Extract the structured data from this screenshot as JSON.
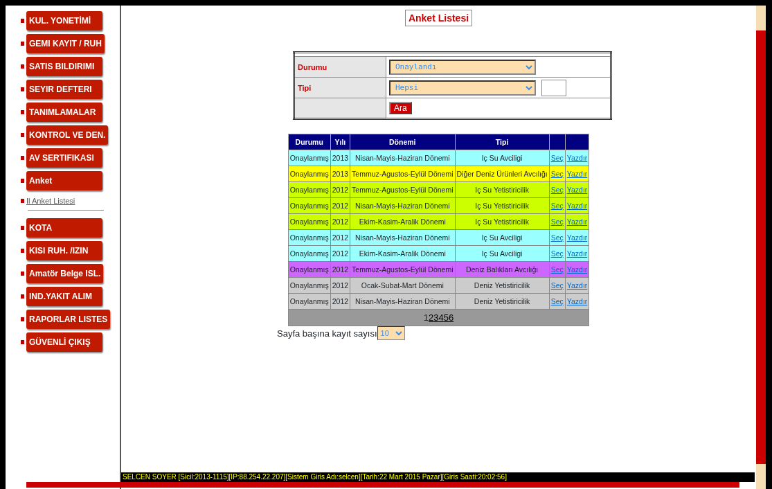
{
  "sidebar": {
    "items": [
      {
        "label": "KUL. YONETİMİ",
        "kind": "menu"
      },
      {
        "label": "GEMI KAYIT / RUH",
        "kind": "menu"
      },
      {
        "label": "SATIS BILDIRIMI",
        "kind": "menu"
      },
      {
        "label": "SEYIR DEFTERI",
        "kind": "menu"
      },
      {
        "label": "TANIMLAMALAR",
        "kind": "menu"
      },
      {
        "label": "KONTROL VE DEN.",
        "kind": "menu"
      },
      {
        "label": "AV SERTIFIKASI",
        "kind": "menu"
      },
      {
        "label": "Anket",
        "kind": "menu"
      },
      {
        "label": "Il Anket Listesi",
        "kind": "sub"
      },
      {
        "label": "KOTA",
        "kind": "menu"
      },
      {
        "label": "KISI RUH. /IZIN",
        "kind": "menu"
      },
      {
        "label": "Amatör Belge ISL.",
        "kind": "menu"
      },
      {
        "label": "IND.YAKIT ALIM",
        "kind": "menu"
      },
      {
        "label": "RAPORLAR LISTES",
        "kind": "menu"
      },
      {
        "label": "GÜVENLİ ÇIKIŞ",
        "kind": "menu"
      }
    ]
  },
  "page_title": "Anket Listesi",
  "filters": {
    "durumu": {
      "label": "Durumu",
      "value": "Onaylandı"
    },
    "tipi": {
      "label": "Tipi",
      "value": "Hepsi"
    },
    "search_button": "Ara"
  },
  "table": {
    "columns": [
      "Durumu",
      "Yılı",
      "Dönemi",
      "Tipi"
    ],
    "rows": [
      {
        "color": "#99ffff",
        "cells": [
          "Onaylanmış",
          "2013",
          "Nisan-Mayis-Haziran Dönemi",
          "Iç Su Avciligi"
        ],
        "select": "Seç",
        "print": "Yazdır"
      },
      {
        "color": "#ffff00",
        "cells": [
          "Onaylanmış",
          "2013",
          "Temmuz-Agustos-Eylül Dönemi",
          "Diğer Deniz Ürünleri Avcılığı"
        ],
        "select": "Seç",
        "print": "Yazdır"
      },
      {
        "color": "#ccff00",
        "cells": [
          "Onaylanmış",
          "2012",
          "Temmuz-Agustos-Eylül Dönemi",
          "Iç Su Yetistiricilik"
        ],
        "select": "Seç",
        "print": "Yazdır"
      },
      {
        "color": "#ccff00",
        "cells": [
          "Onaylanmış",
          "2012",
          "Nisan-Mayis-Haziran Dönemi",
          "Iç Su Yetistiricilik"
        ],
        "select": "Seç",
        "print": "Yazdır"
      },
      {
        "color": "#ccff00",
        "cells": [
          "Onaylanmış",
          "2012",
          "Ekim-Kasim-Aralik Dönemi",
          "Iç Su Yetistiricilik"
        ],
        "select": "Seç",
        "print": "Yazdır"
      },
      {
        "color": "#99ffff",
        "cells": [
          "Onaylanmış",
          "2012",
          "Nisan-Mayis-Haziran Dönemi",
          "Iç Su Avciligi"
        ],
        "select": "Seç",
        "print": "Yazdır"
      },
      {
        "color": "#99ffff",
        "cells": [
          "Onaylanmış",
          "2012",
          "Ekim-Kasim-Aralik Dönemi",
          "Iç Su Avciligi"
        ],
        "select": "Seç",
        "print": "Yazdır"
      },
      {
        "color": "#cc66ff",
        "cells": [
          "Onaylanmış",
          "2012",
          "Temmuz-Agustos-Eylül Dönemi",
          "Deniz Balıkları Avcılığı"
        ],
        "select": "Seç",
        "print": "Yazdır"
      },
      {
        "color": "#cccccc",
        "cells": [
          "Onaylanmış",
          "2012",
          "Ocak-Subat-Mart Dönemi",
          "Deniz Yetistiricilik"
        ],
        "select": "Seç",
        "print": "Yazdır"
      },
      {
        "color": "#cccccc",
        "cells": [
          "Onaylanmış",
          "2012",
          "Nisan-Mayis-Haziran Dönemi",
          "Deniz Yetistiricilik"
        ],
        "select": "Seç",
        "print": "Yazdır"
      }
    ],
    "pages": [
      {
        "label": "1",
        "selected": true
      },
      {
        "label": "2",
        "selected": false
      },
      {
        "label": "3",
        "selected": false
      },
      {
        "label": "4",
        "selected": false
      },
      {
        "label": "5",
        "selected": false
      },
      {
        "label": "6",
        "selected": false
      }
    ],
    "page_size": {
      "label": "Sayfa başına kayıt sayısı",
      "value": "10"
    }
  },
  "status_bar": "SELCEN SOYER [Sicil:2013-1115][IP:88.254.22.207][Sistem Giris Adı:selcen][Tarih:22 Mart 2015 Pazar][Giris Saati:20:02:56]"
}
